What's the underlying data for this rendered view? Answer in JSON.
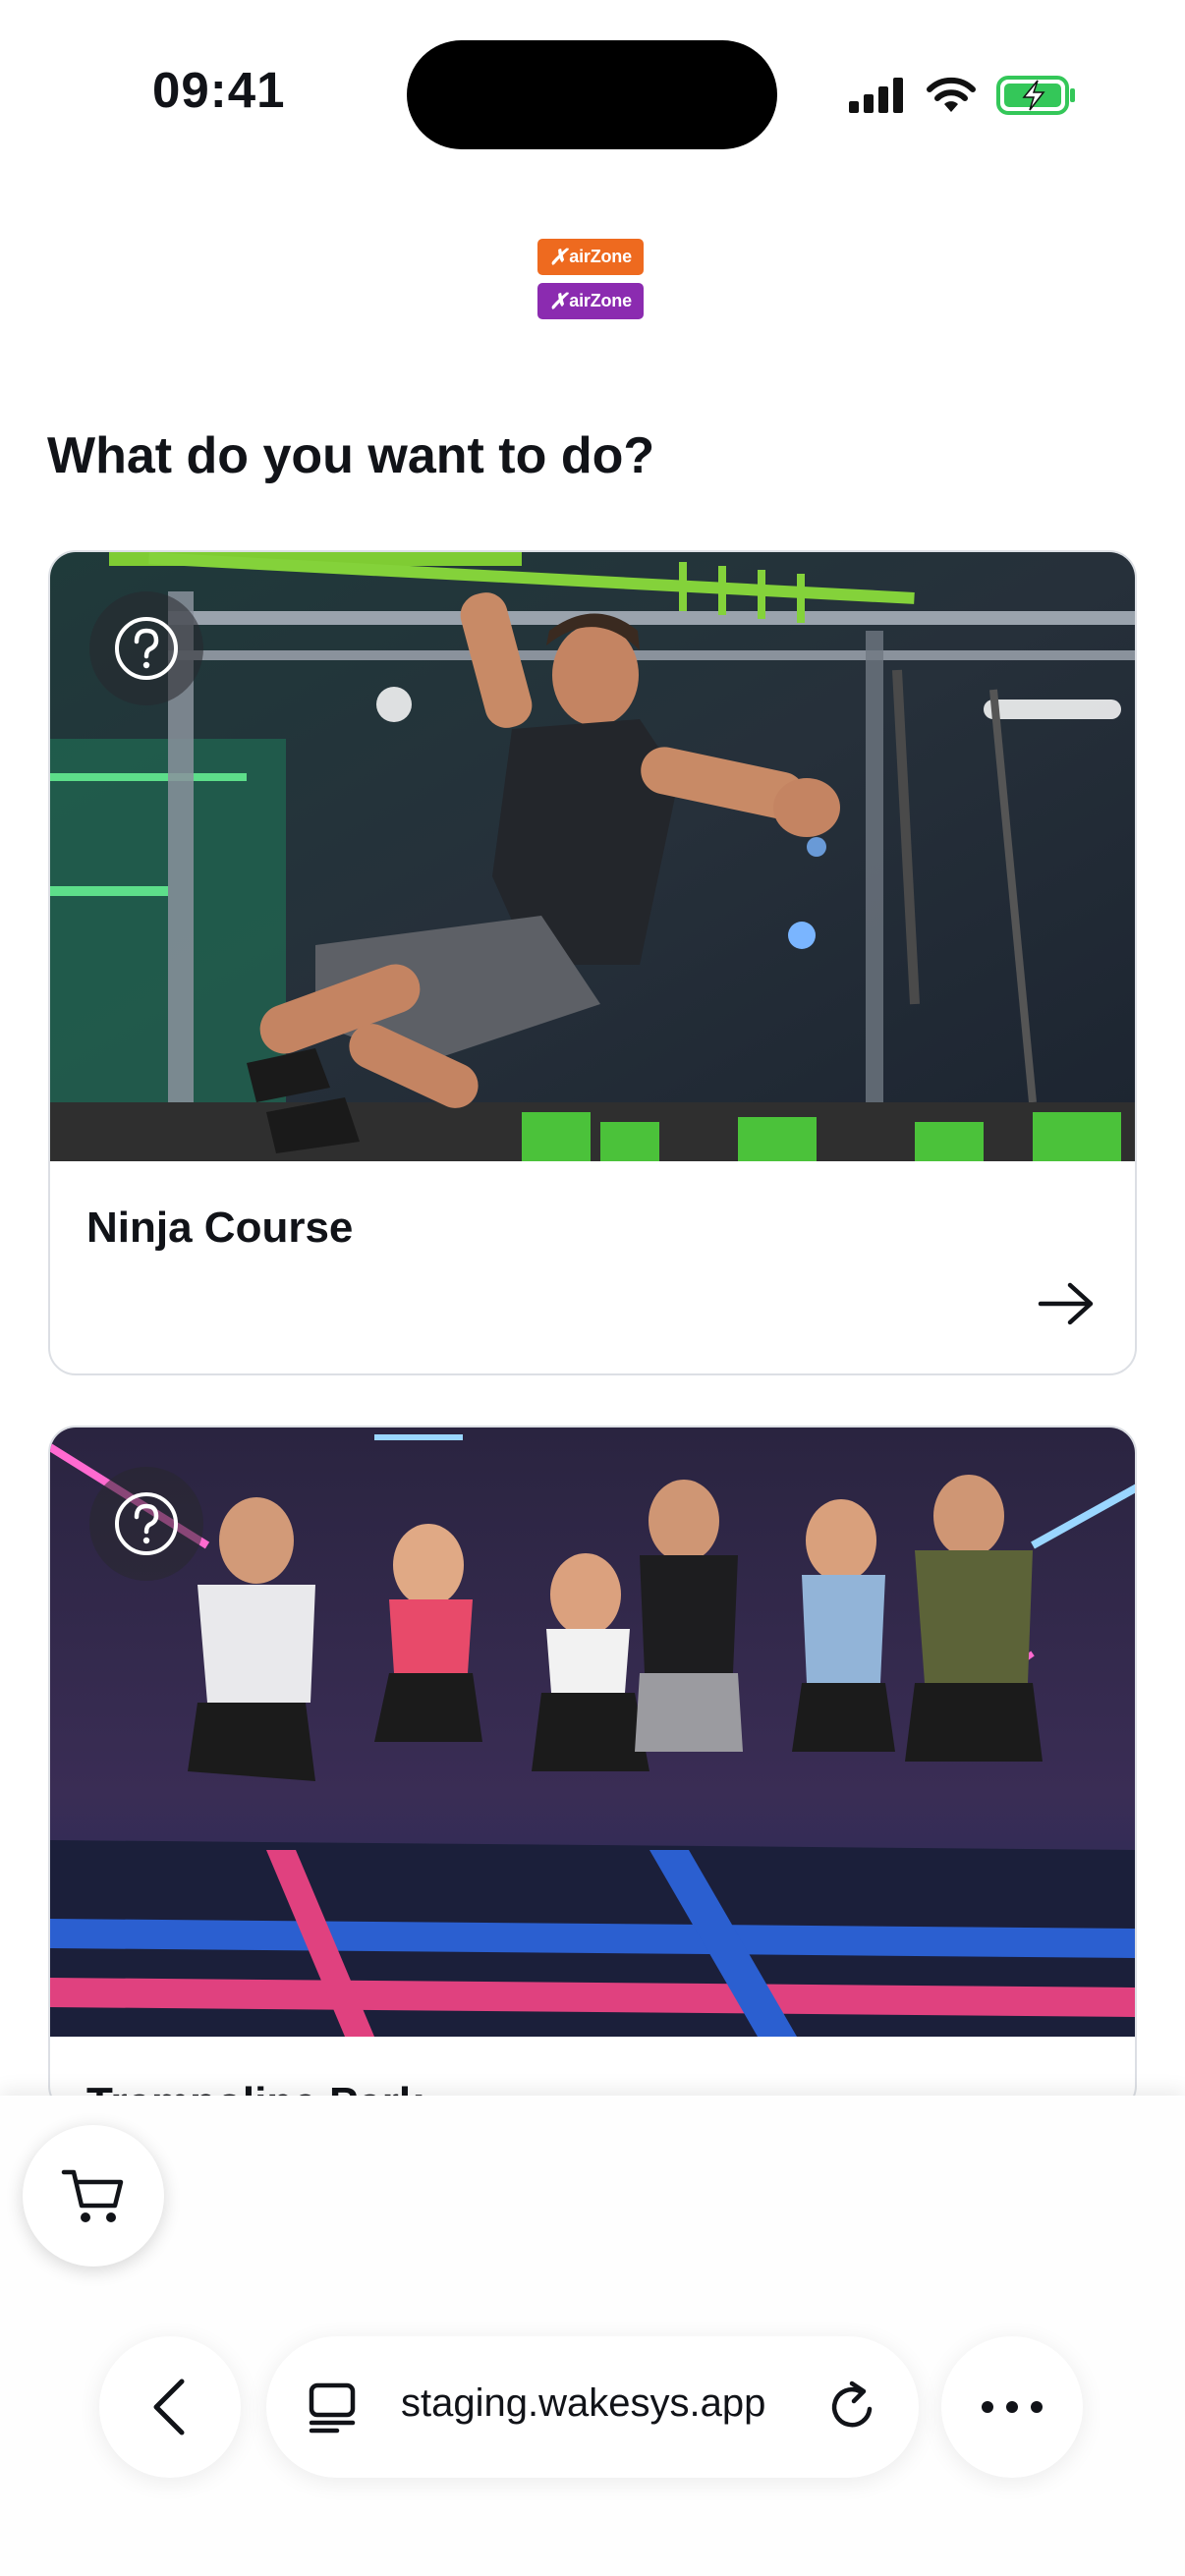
{
  "status_bar": {
    "time": "09:41"
  },
  "logo": {
    "top_text": "airZone",
    "bottom_text": "airZone",
    "top_color": "#ee6a1f",
    "bottom_color": "#8b2bb0"
  },
  "page_title": "What do you want to do?",
  "cards": [
    {
      "title": "Ninja Course",
      "image": "ninja-course-photo",
      "help_icon": "question-circle-icon",
      "arrow_icon": "arrow-right-icon"
    },
    {
      "title": "Trampoline Park",
      "image": "trampoline-park-photo",
      "help_icon": "question-circle-icon"
    }
  ],
  "browser": {
    "url": "staging.wakesys.app",
    "icons": [
      "cart-icon",
      "back-chevron-icon",
      "tab-overview-icon",
      "reload-icon",
      "more-icon"
    ]
  },
  "colors": {
    "text": "#111318",
    "card_border": "#dcdfe4",
    "battery_green": "#34c759"
  }
}
